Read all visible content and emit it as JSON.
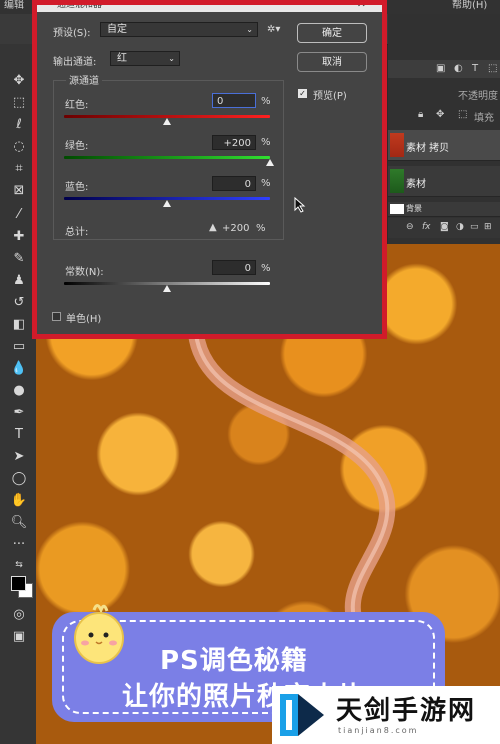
{
  "menubar": {
    "left": "编辑",
    "right": "帮助(H)"
  },
  "dialog": {
    "title": "通道混和器",
    "preset_label": "预设(S):",
    "preset_value": "自定",
    "output_label": "输出通道:",
    "output_value": "红",
    "source_group": "源通道",
    "red_label": "红色:",
    "red_value": "0",
    "green_label": "绿色:",
    "green_value": "+200",
    "blue_label": "蓝色:",
    "blue_value": "0",
    "pct": "%",
    "total_label": "总计:",
    "total_value": "+200",
    "total_warning_icon": "warning-triangle-icon",
    "constant_label": "常数(N):",
    "constant_value": "0",
    "mono_label": "单色(H)",
    "ok_button": "确定",
    "cancel_button": "取消",
    "preview_label": "预览(P)",
    "preview_checked": true,
    "slider_levels": {
      "red": 0.5,
      "green": 1.0,
      "blue": 0.5,
      "constant": 0.5
    }
  },
  "layers": {
    "opacity_label": "不透明度",
    "fill_label": "填充",
    "items": [
      {
        "name": "素材 拷贝",
        "selected": true
      },
      {
        "name": "素材",
        "selected": false
      },
      {
        "name": "背景",
        "selected": false
      }
    ],
    "footer_icons": [
      "link-icon",
      "fx-icon",
      "mask-icon",
      "adjustment-icon",
      "folder-icon",
      "new-layer-icon",
      "trash-icon"
    ]
  },
  "banner": {
    "line1": "PS调色秘籍",
    "line2": "让你的照片秒变大片!",
    "color": "#7b7fe6"
  },
  "watermark": {
    "name": "天剑手游网",
    "sub": "tianjian8.com"
  },
  "colors": {
    "highlight": "#d11b2a",
    "foliage": "#f2a126"
  }
}
